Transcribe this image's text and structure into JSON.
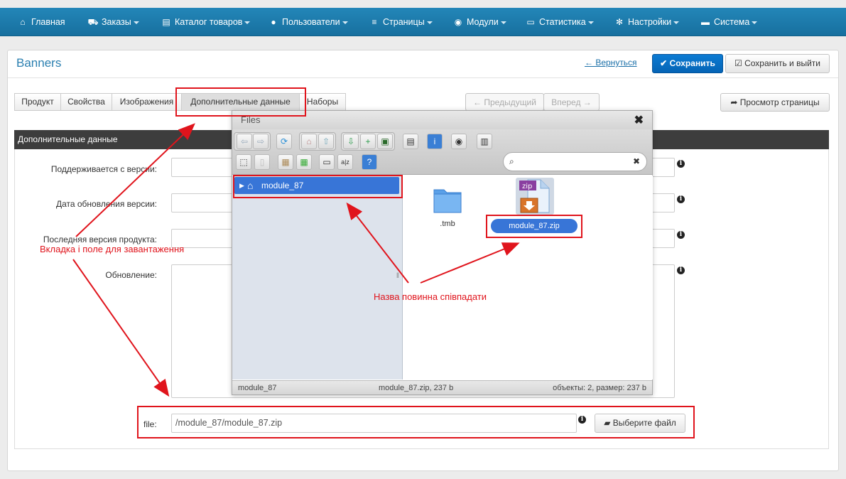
{
  "navbar": {
    "items": [
      {
        "label": "Главная",
        "icon": "home-icon",
        "glyph": "⌂",
        "caret": false
      },
      {
        "label": "Заказы",
        "icon": "cart-icon",
        "glyph": "🛒",
        "caret": true
      },
      {
        "label": "Каталог товаров",
        "icon": "catalog-icon",
        "glyph": "▤",
        "caret": true
      },
      {
        "label": "Пользователи",
        "icon": "user-icon",
        "glyph": "●",
        "caret": true
      },
      {
        "label": "Страницы",
        "icon": "pages-icon",
        "glyph": "≡",
        "caret": true
      },
      {
        "label": "Модули",
        "icon": "module-icon",
        "glyph": "◉",
        "caret": true
      },
      {
        "label": "Статистика",
        "icon": "monitor-icon",
        "glyph": "▭",
        "caret": true
      },
      {
        "label": "Настройки",
        "icon": "gear-icon",
        "glyph": "✻",
        "caret": true
      },
      {
        "label": "Система",
        "icon": "system-icon",
        "glyph": "▬",
        "caret": true
      }
    ]
  },
  "header": {
    "title": "Banners",
    "back_label": "← Вернуться",
    "save_label": "Сохранить",
    "save_exit_label": "Сохранить и выйти"
  },
  "tabs": [
    "Продукт",
    "Свойства",
    "Изображения",
    "Дополнительные данные",
    "Наборы"
  ],
  "pager": {
    "prev": "← Предыдущий",
    "next": "Вперед →"
  },
  "preview_label": "Просмотр страницы",
  "section_title": "Дополнительные данные",
  "form": {
    "supported_from": "Поддерживается с версии:",
    "update_date": "Дата обновления версии:",
    "latest_version": "Последняя версия продукта:",
    "update": "Обновление:",
    "file_label": "file:",
    "file_value": "/module_87/module_87.zip",
    "choose_file": "Выберите файл"
  },
  "dialog": {
    "title": "Files",
    "tree_root": "module_87",
    "items": [
      {
        "name": ".tmb",
        "type": "folder"
      },
      {
        "name": "module_87.zip",
        "type": "zip",
        "badge": "zip"
      }
    ],
    "status_left": "module_87",
    "status_mid": "module_87.zip, 237 b",
    "status_right": "объекты: 2, размер: 237 b"
  },
  "annotations": {
    "tab_and_field": "Вкладка і поле для завантаження",
    "name_match": "Назва повинна співпадати",
    "color": "#e0141c"
  }
}
